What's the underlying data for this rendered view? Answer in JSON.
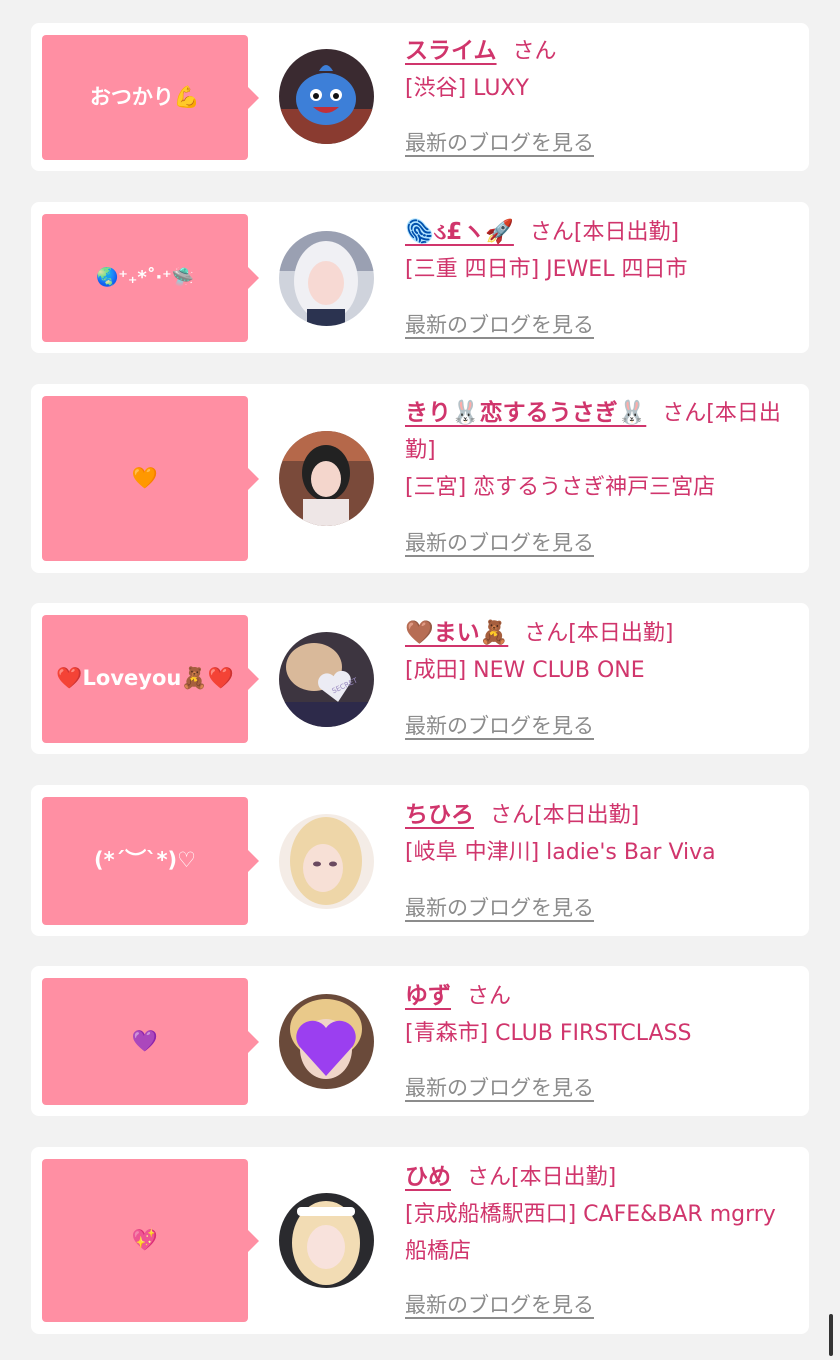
{
  "blog_link_label": "最新のブログを見る",
  "honorific": "さん",
  "cast": [
    {
      "message": "おつかり💪",
      "name": "スライム",
      "status": "",
      "shop": "[渋谷] LUXY",
      "avatar_icon": "slime-mascot-photo"
    },
    {
      "message": "🌏⁺₊*˚‧⁺🛸",
      "name": "🫆ડ£ヽ🚀",
      "status": "[本日出勤]",
      "shop": "[三重 四日市] JEWEL 四日市",
      "avatar_icon": "girl-with-white-hair-photo"
    },
    {
      "message": "🧡",
      "name": "きり🐰恋するうさぎ🐰",
      "status": "[本日出勤]",
      "shop": "[三宮] 恋するうさぎ神戸三宮店",
      "avatar_icon": "girl-with-bangs-photo"
    },
    {
      "message": "❤️Loveyou🧸❤️",
      "name": "🤎まい🧸",
      "status": "[本日出勤]",
      "shop": "[成田] NEW CLUB ONE",
      "avatar_icon": "secret-heart-photo"
    },
    {
      "message": "(*´︶`*)♡",
      "name": "ちひろ",
      "status": "[本日出勤]",
      "shop": "[岐阜 中津川] ladie's Bar Viva",
      "avatar_icon": "blonde-girl-photo"
    },
    {
      "message": "💜",
      "name": "ゆず",
      "status": "",
      "shop": "[青森市] CLUB FIRSTCLASS",
      "avatar_icon": "purple-heart-photo"
    },
    {
      "message": "💖",
      "name": "ひめ",
      "status": "[本日出勤]",
      "shop": "[京成船橋駅西口] CAFE&BAR mgrry 船橋店",
      "avatar_icon": "blonde-girl-headband-photo"
    }
  ],
  "colors": {
    "bubble": "#ff8fa3",
    "accent": "#d0356c",
    "link_gray": "#8c8c8c",
    "background": "#f2f2f2"
  }
}
